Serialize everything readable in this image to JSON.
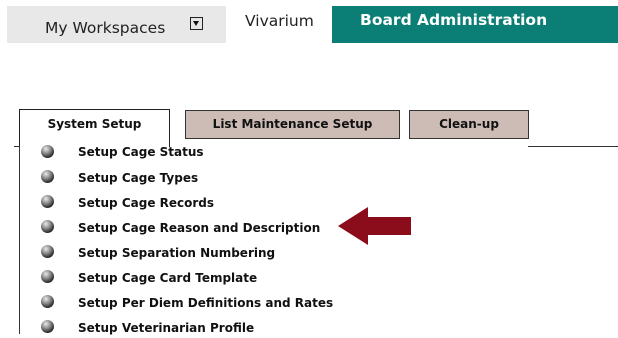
{
  "topnav": {
    "workspaces_label": "My Workspaces",
    "vivarium_label": "Vivarium",
    "board_admin_label": "Board Administration",
    "accent_color": "#0b7f76"
  },
  "subtabs": {
    "system_setup": "System Setup",
    "list_maintenance": "List Maintenance Setup",
    "clean_up": "Clean-up",
    "inactive_color": "#cdbcb6"
  },
  "setup_items": [
    {
      "label": "Setup Cage Status"
    },
    {
      "label": "Setup Cage Types"
    },
    {
      "label": "Setup Cage Records"
    },
    {
      "label": "Setup Cage Reason and Description"
    },
    {
      "label": "Setup Separation Numbering"
    },
    {
      "label": "Setup Cage Card Template"
    },
    {
      "label": "Setup Per Diem Definitions and Rates"
    },
    {
      "label": "Setup Veterinarian Profile"
    }
  ],
  "annotation": {
    "arrow_color": "#8b0d1c",
    "arrow_points_to": "Setup Cage Reason and Description"
  }
}
